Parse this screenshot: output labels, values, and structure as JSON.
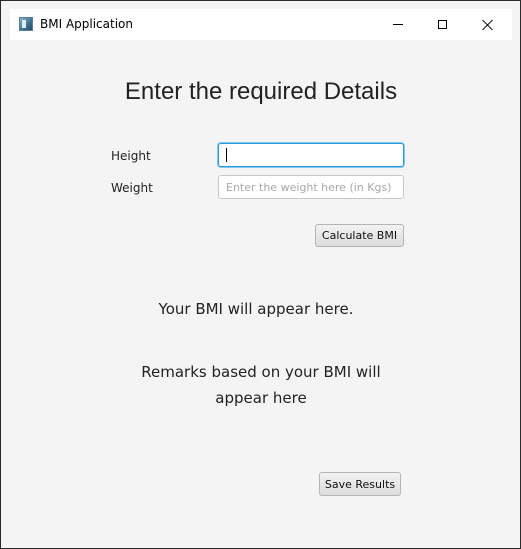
{
  "window": {
    "title": "BMI Application"
  },
  "form": {
    "heading": "Enter the required Details",
    "height_label": "Height",
    "height_value": "",
    "weight_label": "Weight",
    "weight_value": "",
    "weight_placeholder": "Enter the weight here (in Kgs)",
    "calculate_label": "Calculate BMI"
  },
  "output": {
    "bmi_text": "Your BMI will appear here.",
    "remarks_text": "Remarks based on your BMI will appear here"
  },
  "actions": {
    "save_label": "Save Results"
  },
  "icons": {
    "app": "app-window-icon",
    "minimize": "minimize-icon",
    "maximize": "maximize-icon",
    "close": "close-icon"
  },
  "colors": {
    "focus_border": "#2a9bd6",
    "background": "#f4f4f4"
  }
}
